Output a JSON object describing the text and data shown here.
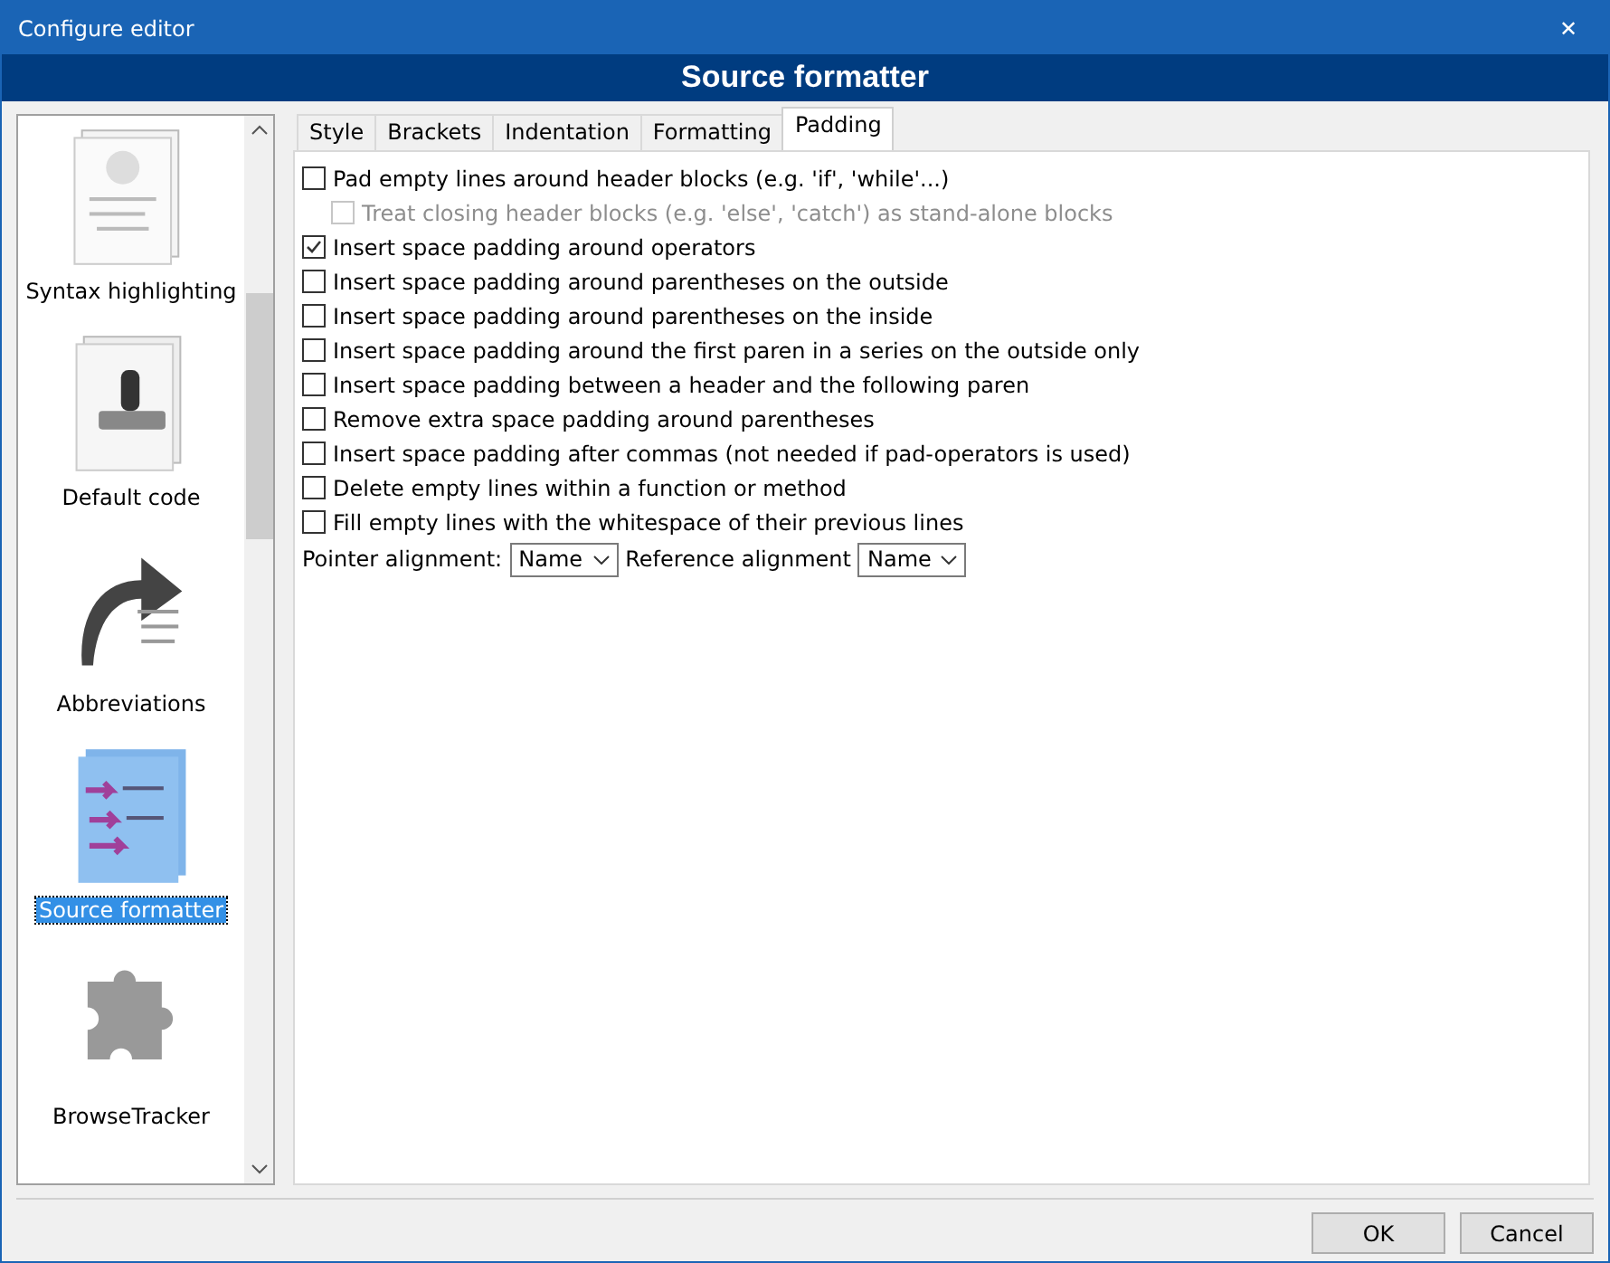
{
  "window": {
    "title": "Configure editor",
    "close": "✕"
  },
  "header": "Source formatter",
  "sidebar": {
    "items": [
      {
        "label": "Syntax highlighting",
        "selected": false
      },
      {
        "label": "Default code",
        "selected": false
      },
      {
        "label": "Abbreviations",
        "selected": false
      },
      {
        "label": "Source formatter",
        "selected": true
      },
      {
        "label": "BrowseTracker",
        "selected": false
      }
    ]
  },
  "tabs": [
    {
      "label": "Style",
      "selected": false
    },
    {
      "label": "Brackets",
      "selected": false
    },
    {
      "label": "Indentation",
      "selected": false
    },
    {
      "label": "Formatting",
      "selected": false
    },
    {
      "label": "Padding",
      "selected": true
    }
  ],
  "options": [
    {
      "label": "Pad empty lines around header blocks (e.g. 'if', 'while'...)",
      "checked": false,
      "disabled": false,
      "children": [
        {
          "label": "Treat closing header blocks (e.g. 'else', 'catch') as stand-alone blocks",
          "checked": false,
          "disabled": true
        }
      ]
    },
    {
      "label": "Insert space padding around operators",
      "checked": true,
      "disabled": false
    },
    {
      "label": "Insert space padding around parentheses on the outside",
      "checked": false,
      "disabled": false
    },
    {
      "label": "Insert space padding around parentheses on the inside",
      "checked": false,
      "disabled": false
    },
    {
      "label": "Insert space padding around the first paren in a series on the outside only",
      "checked": false,
      "disabled": false
    },
    {
      "label": "Insert space padding between a header and the following paren",
      "checked": false,
      "disabled": false
    },
    {
      "label": "Remove extra space padding around parentheses",
      "checked": false,
      "disabled": false
    },
    {
      "label": "Insert space padding after commas (not needed if pad-operators is used)",
      "checked": false,
      "disabled": false
    },
    {
      "label": "Delete empty lines within a function or method",
      "checked": false,
      "disabled": false
    },
    {
      "label": "Fill empty lines with the whitespace of their previous lines",
      "checked": false,
      "disabled": false
    }
  ],
  "alignment": [
    {
      "label": "Pointer alignment:",
      "value": "Name"
    },
    {
      "label": "Reference alignment",
      "value": "Name"
    }
  ],
  "buttons": [
    "OK",
    "Cancel"
  ]
}
